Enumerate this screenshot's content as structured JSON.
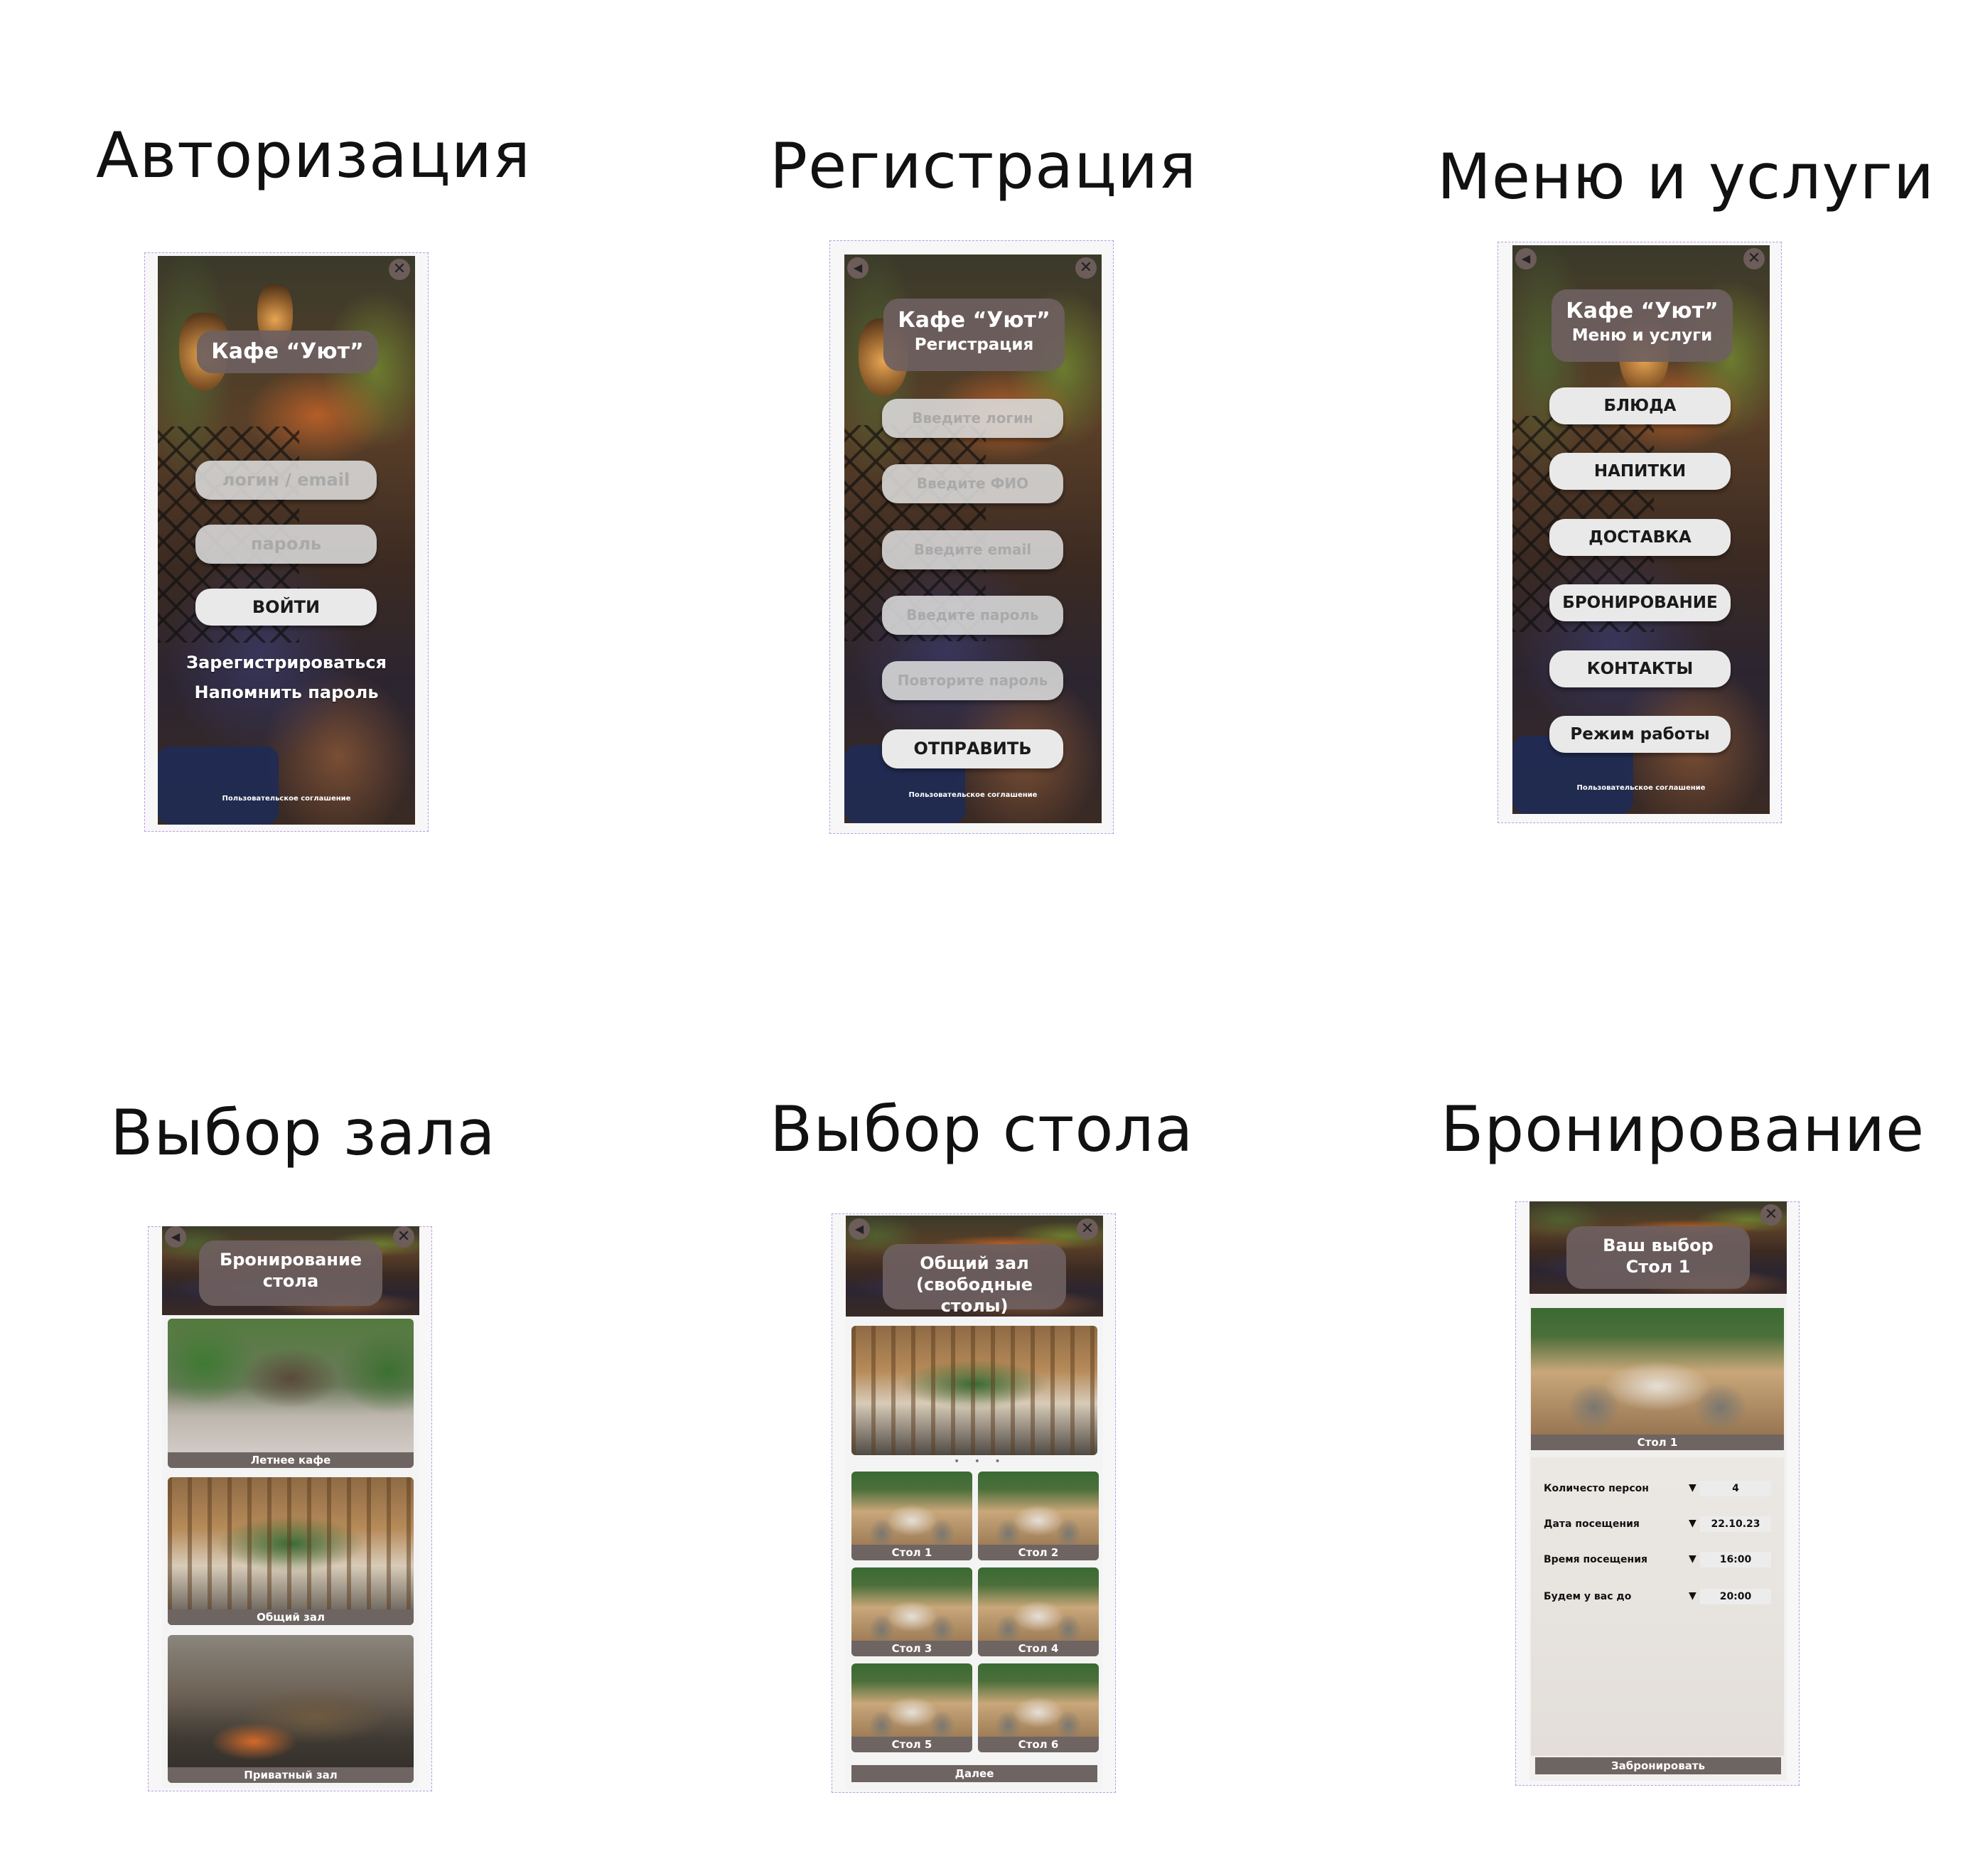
{
  "section_titles": {
    "auth": "Авторизация",
    "register": "Регистрация",
    "menu": "Меню и услуги",
    "hall": "Выбор зала",
    "table": "Выбор стола",
    "booking": "Бронирование"
  },
  "icons": {
    "close": "✕",
    "back": "◀"
  },
  "auth": {
    "cafe_title": "Кафе “Уют”",
    "login_placeholder": "логин / email",
    "password_placeholder": "пароль",
    "login_button": "ВОЙТИ",
    "register_link": "Зарегистрироваться",
    "remind_link": "Напомнить пароль",
    "agreement": "Пользовательское соглашение"
  },
  "register": {
    "cafe_title": "Кафе “Уют”",
    "subtitle": "Регистрация",
    "login_placeholder": "Введите логин",
    "fio_placeholder": "Введите ФИО",
    "email_placeholder": "Введите email",
    "password_placeholder": "Введите пароль",
    "repeat_placeholder": "Повторите пароль",
    "submit_button": "ОТПРАВИТЬ",
    "agreement": "Пользовательское соглашение"
  },
  "menu": {
    "cafe_title": "Кафе “Уют”",
    "subtitle": "Меню и услуги",
    "items": [
      "БЛЮДА",
      "НАПИТКИ",
      "ДОСТАВКА",
      "БРОНИРОВАНИЕ",
      "КОНТАКТЫ",
      "Режим работы"
    ],
    "agreement": "Пользовательское соглашение"
  },
  "hall": {
    "header_line1": "Бронирование",
    "header_line2": "стола",
    "halls": [
      "Летнее кафе",
      "Общий зал",
      "Приватный зал"
    ]
  },
  "table": {
    "header_line1": "Общий зал",
    "header_line2": "(свободные столы)",
    "tables": [
      "Стол 1",
      "Стол 2",
      "Стол 3",
      "Стол 4",
      "Стол 5",
      "Стол 6"
    ],
    "next_button": "Далее",
    "carousel_dots": "• • •"
  },
  "booking": {
    "header_line1": "Ваш выбор",
    "header_line2": "Стол 1",
    "selected_table": "Стол 1",
    "fields": [
      {
        "label": "Количесто персон",
        "value": "4"
      },
      {
        "label": "Дата посещения",
        "value": "22.10.23"
      },
      {
        "label": "Время посещения",
        "value": "16:00"
      },
      {
        "label": "Будем у вас до",
        "value": "20:00"
      }
    ],
    "dropdown_arrow": "▼",
    "submit_button": "Забронировать"
  },
  "colors": {
    "header_bg": "#6e6060",
    "caption_bg": "#6e6462",
    "frame_border": "#b99ce8"
  }
}
